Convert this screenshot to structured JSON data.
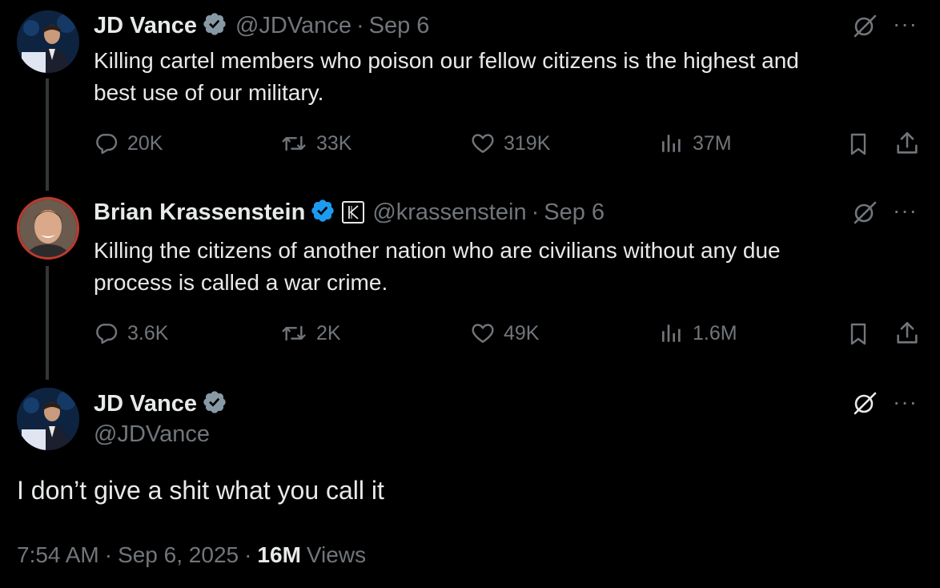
{
  "tweet1": {
    "name": "JD Vance",
    "handle": "@JDVance",
    "sep": "·",
    "date": "Sep 6",
    "text_line1": "Killing cartel members who poison our fellow citizens is the highest and",
    "text_line2": "best use of our military.",
    "replies": "20K",
    "reposts": "33K",
    "likes": "319K",
    "views": "37M"
  },
  "tweet2": {
    "name": "Brian Krassenstein",
    "handle": "@krassenstein",
    "sep": "·",
    "date": "Sep 6",
    "text_line1": "Killing the citizens of another nation who are civilians without any due",
    "text_line2": "process is called a war crime.",
    "replies": "3.6K",
    "reposts": "2K",
    "likes": "49K",
    "views": "1.6M"
  },
  "tweet3": {
    "name": "JD Vance",
    "handle": "@JDVance",
    "text": "I don’t give a shit what you call it",
    "time": "7:54 AM",
    "sep": "·",
    "date": "Sep 6, 2025",
    "sep2": "·",
    "views_count": "16M",
    "views_label": "Views"
  },
  "more_label": "···",
  "colors": {
    "background": "#000000",
    "text": "#e7e9ea",
    "muted": "#71767b",
    "verified": "#8899a6",
    "krassenstein_ring": "#c0392b"
  }
}
